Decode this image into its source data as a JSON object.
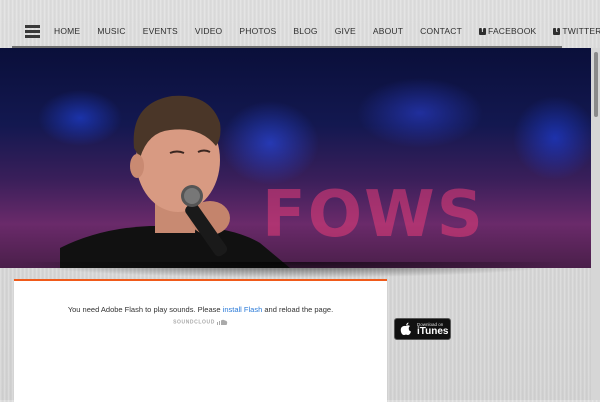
{
  "nav": {
    "items": [
      {
        "label": "HOME"
      },
      {
        "label": "MUSIC"
      },
      {
        "label": "EVENTS"
      },
      {
        "label": "VIDEO"
      },
      {
        "label": "PHOTOS"
      },
      {
        "label": "BLOG"
      },
      {
        "label": "GIVE"
      },
      {
        "label": "ABOUT"
      },
      {
        "label": "CONTACT"
      },
      {
        "label": "FACEBOOK",
        "icon": "facebook-icon",
        "icon_glyph": "f"
      },
      {
        "label": "TWITTER",
        "icon": "twitter-icon",
        "icon_glyph": "t"
      }
    ]
  },
  "hero": {
    "backdrop_text": "FOWS"
  },
  "player": {
    "message_before": "You need Adobe Flash to play sounds. Please ",
    "link_text": "install Flash",
    "message_after": " and reload the page.",
    "brand": "SOUNDCLOUD"
  },
  "itunes": {
    "small": "Download on",
    "big": "iTunes"
  },
  "colors": {
    "accent": "#f05a1a",
    "link": "#2a7ad8"
  }
}
